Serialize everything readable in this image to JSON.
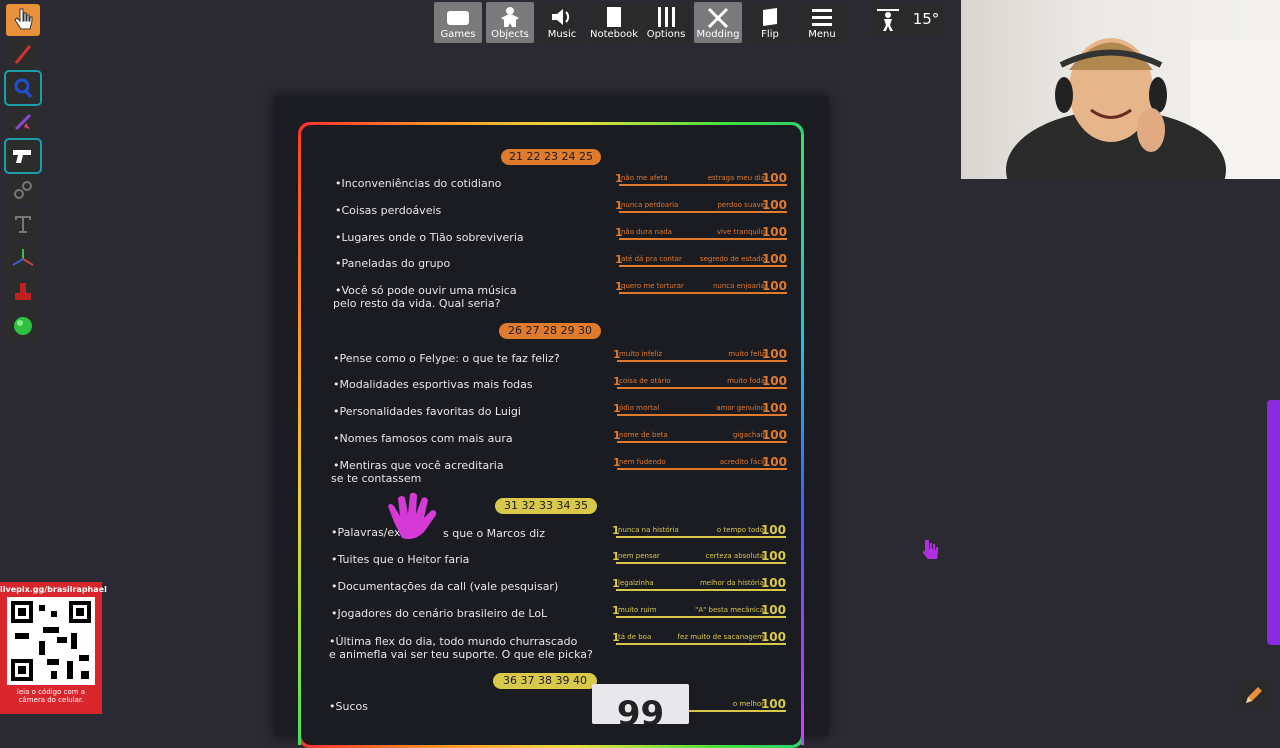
{
  "toolbar": {
    "games": "Games",
    "objects": "Objects",
    "music": "Music",
    "notebook": "Notebook",
    "options": "Options",
    "modding": "Modding",
    "flip": "Flip",
    "menu": "Menu",
    "rotation": "15°"
  },
  "sections": [
    {
      "numbers": "21 22 23 24 25",
      "color": "orange",
      "items": [
        {
          "q1": "•Inconveniências do cotidiano",
          "q2": "",
          "lo": "não me afeta",
          "hi": "estraga meu dia"
        },
        {
          "q1": "•Coisas perdoáveis",
          "q2": "",
          "lo": "nunca perdoaria",
          "hi": "perdoo suave"
        },
        {
          "q1": "•Lugares onde o Tião sobreviveria",
          "q2": "",
          "lo": "não dura nada",
          "hi": "vive tranquilo"
        },
        {
          "q1": "•Paneladas do grupo",
          "q2": "",
          "lo": "até dá pra contar",
          "hi": "segredo de estado"
        },
        {
          "q1": "•Você só pode ouvir uma música",
          "q2": "pelo resto da vida. Qual seria?",
          "lo": "quero me torturar",
          "hi": "nunca enjoaria"
        }
      ]
    },
    {
      "numbers": "26 27 28 29 30",
      "color": "orange",
      "items": [
        {
          "q1": "•Pense como o Felype: o que te faz feliz?",
          "q2": "",
          "lo": "muito infeliz",
          "hi": "muito feliz"
        },
        {
          "q1": "•Modalidades esportivas mais fodas",
          "q2": "",
          "lo": "coisa de otário",
          "hi": "muito foda"
        },
        {
          "q1": "•Personalidades favoritas do Luigi",
          "q2": "",
          "lo": "ódio mortal",
          "hi": "amor genuíno"
        },
        {
          "q1": "•Nomes famosos com mais aura",
          "q2": "",
          "lo": "nome de beta",
          "hi": "gigachad"
        },
        {
          "q1": "•Mentiras que você acreditaria",
          "q2": "se te contassem",
          "lo": "nem fudendo",
          "hi": "acredito fácil"
        }
      ]
    },
    {
      "numbers": "31 32 33 34 35",
      "color": "yellow",
      "items": [
        {
          "q1": "•Palavras/ex",
          "q1b": "s que o Marcos diz",
          "q2": "",
          "lo": "nunca na história",
          "hi": "o tempo todo"
        },
        {
          "q1": "•Tuites que o Heitor faria",
          "q2": "",
          "lo": "nem pensar",
          "hi": "certeza absoluta"
        },
        {
          "q1": "•Documentações da call (vale pesquisar)",
          "q2": "",
          "lo": "legalzinha",
          "hi": "melhor da história"
        },
        {
          "q1": "•Jogadores do cenário brasileiro de LoL",
          "q2": "",
          "lo": "muito ruim",
          "hi": "\"A\" besta mecânica"
        },
        {
          "q1": "•Última flex do dia, todo mundo churrascado",
          "q2": "e animefla vai ser teu suporte. O que ele picka?",
          "lo": "tá de boa",
          "hi": "fez muito de sacanagem"
        }
      ]
    },
    {
      "numbers": "36 37 38 39 40",
      "color": "yellow",
      "items": [
        {
          "q1": "•Sucos",
          "q2": "",
          "lo": "",
          "hi": "o melhor"
        }
      ]
    }
  ],
  "scale": {
    "one": "1",
    "hundred": "100"
  },
  "qr": {
    "top": "livepix.gg/brasilraphael",
    "bottom1": "leia o código com a",
    "bottom2": "câmera do celular."
  },
  "card": {
    "value": "99"
  },
  "colors": {
    "orange": "#e07a2c",
    "yellow": "#d8c94a",
    "tool_active": "#e9903a",
    "qr_bg": "#d8262c",
    "hand": "#d63ad6"
  }
}
